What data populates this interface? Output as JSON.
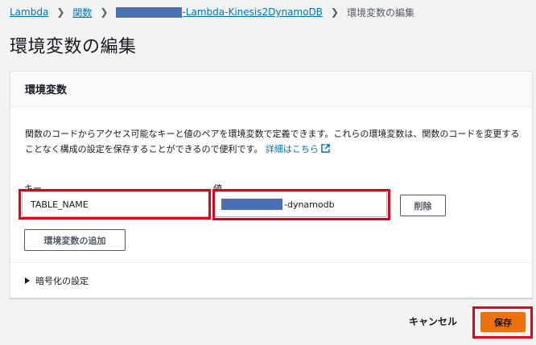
{
  "breadcrumb": {
    "lambda": "Lambda",
    "functions": "関数",
    "function_name_suffix": "-Lambda-Kinesis2DynamoDB",
    "current": "環境変数の編集"
  },
  "page": {
    "title": "環境変数の編集"
  },
  "panel": {
    "header": "環境変数",
    "description": "関数のコードからアクセス可能なキーと値のペアを環境変数で定義できます。これらの環境変数は、関数のコードを変更することなく構成の設定を保存することができるので便利です。",
    "details_link": "詳細はこちら",
    "key_label": "キー",
    "value_label": "値",
    "key_value": "TABLE_NAME",
    "value_suffix": "-dynamodb",
    "delete_button": "削除",
    "add_button": "環境変数の追加",
    "encryption_toggle": "暗号化の設定"
  },
  "footer": {
    "cancel": "キャンセル",
    "save": "保存"
  },
  "colors": {
    "link": "#0073bb",
    "primary": "#ec7211",
    "highlight": "#e3001b",
    "redaction": "#4b6fb5"
  }
}
